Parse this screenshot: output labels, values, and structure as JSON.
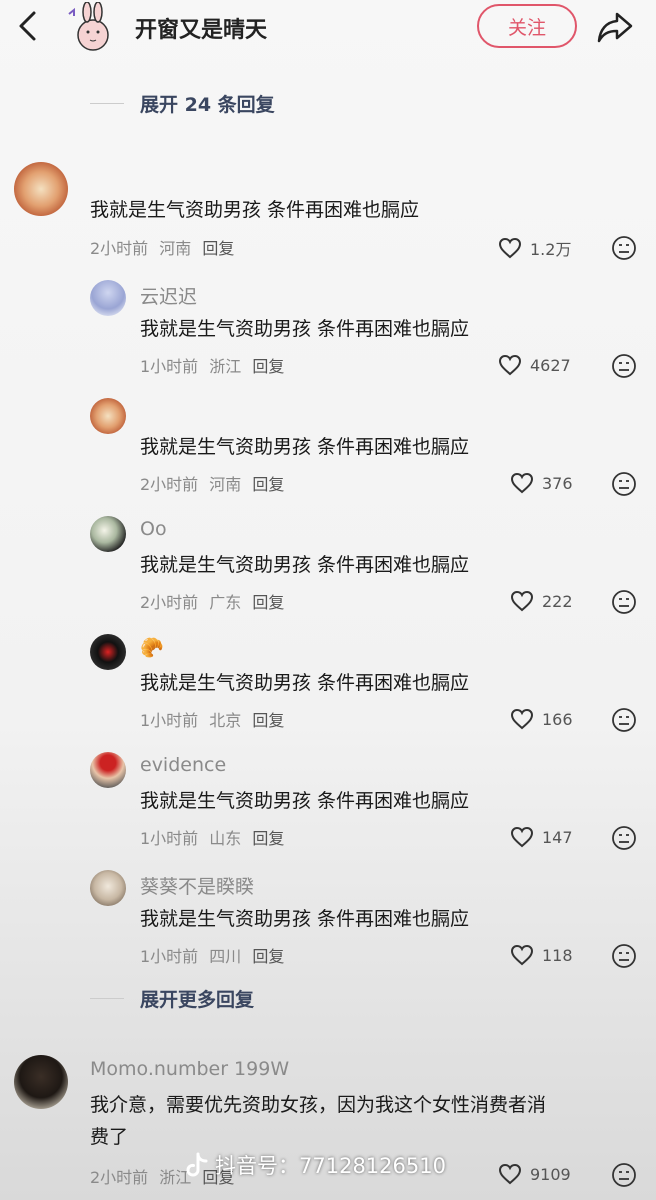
{
  "header": {
    "author_name": "开窗又是晴天",
    "follow_label": "关注"
  },
  "expand_top": "展开 24 条回复",
  "top_comment": {
    "text": "我就是生气资助男孩 条件再困难也膈应",
    "time": "2小时前",
    "location": "河南",
    "reply": "回复",
    "likes": "1.2万"
  },
  "replies": [
    {
      "username": "云迟迟",
      "text": "我就是生气资助男孩 条件再困难也膈应",
      "time": "1小时前",
      "location": "浙江",
      "reply": "回复",
      "likes": "4627"
    },
    {
      "username": "",
      "text": "我就是生气资助男孩 条件再困难也膈应",
      "time": "2小时前",
      "location": "河南",
      "reply": "回复",
      "likes": "376"
    },
    {
      "username": "Oo",
      "text": "我就是生气资助男孩 条件再困难也膈应",
      "time": "2小时前",
      "location": "广东",
      "reply": "回复",
      "likes": "222"
    },
    {
      "username": "🥐",
      "text": "我就是生气资助男孩 条件再困难也膈应",
      "time": "1小时前",
      "location": "北京",
      "reply": "回复",
      "likes": "166"
    },
    {
      "username": "evidence",
      "text": "我就是生气资助男孩 条件再困难也膈应",
      "time": "1小时前",
      "location": "山东",
      "reply": "回复",
      "likes": "147"
    },
    {
      "username": "葵葵不是睽睽",
      "text": "我就是生气资助男孩 条件再困难也膈应",
      "time": "1小时前",
      "location": "四川",
      "reply": "回复",
      "likes": "118"
    }
  ],
  "expand_more": "展开更多回复",
  "bottom_comment": {
    "username": "Momo.number 199W",
    "text_line1": "我介意，需要优先资助女孩，因为我这个女性消费者消",
    "text_line2": "费了",
    "time": "2小时前",
    "location": "浙江",
    "reply": "回复",
    "likes": "9109"
  },
  "watermark": "抖音号：77128126510",
  "colors": {
    "accent": "#e0566a",
    "link": "#3a4660"
  }
}
